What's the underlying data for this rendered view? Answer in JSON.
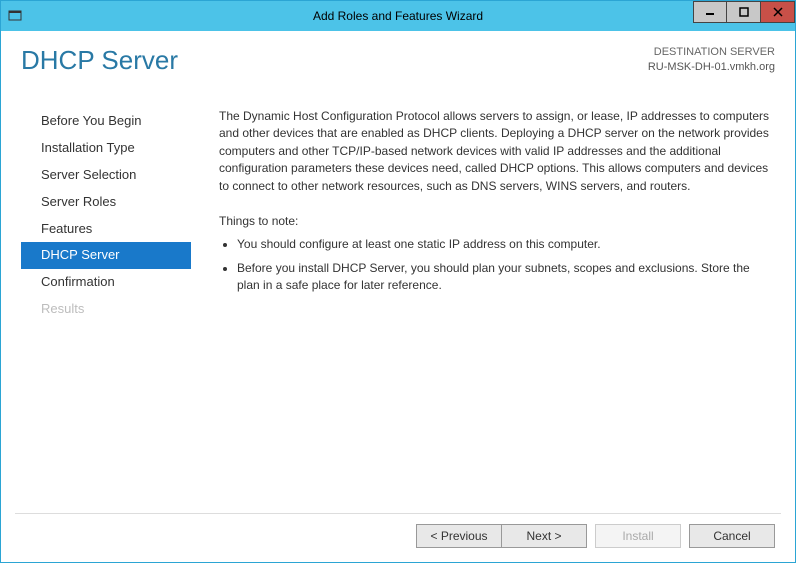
{
  "window": {
    "title": "Add Roles and Features Wizard"
  },
  "header": {
    "page_title": "DHCP Server",
    "destination_label": "DESTINATION SERVER",
    "destination_name": "RU-MSK-DH-01.vmkh.org"
  },
  "sidebar": {
    "items": [
      {
        "label": "Before You Begin",
        "selected": false,
        "disabled": false
      },
      {
        "label": "Installation Type",
        "selected": false,
        "disabled": false
      },
      {
        "label": "Server Selection",
        "selected": false,
        "disabled": false
      },
      {
        "label": "Server Roles",
        "selected": false,
        "disabled": false
      },
      {
        "label": "Features",
        "selected": false,
        "disabled": false
      },
      {
        "label": "DHCP Server",
        "selected": true,
        "disabled": false
      },
      {
        "label": "Confirmation",
        "selected": false,
        "disabled": false
      },
      {
        "label": "Results",
        "selected": false,
        "disabled": true
      }
    ]
  },
  "content": {
    "intro": "The Dynamic Host Configuration Protocol allows servers to assign, or lease, IP addresses to computers and other devices that are enabled as DHCP clients. Deploying a DHCP server on the network provides computers and other TCP/IP-based network devices with valid IP addresses and the additional configuration parameters these devices need, called DHCP options. This allows computers and devices to connect to other network resources, such as DNS servers, WINS servers, and routers.",
    "note_heading": "Things to note:",
    "bullets": [
      "You should configure at least one static IP address on this computer.",
      "Before you install DHCP Server, you should plan your subnets, scopes and exclusions. Store the plan in a safe place for later reference."
    ]
  },
  "buttons": {
    "previous": "< Previous",
    "next": "Next >",
    "install": "Install",
    "cancel": "Cancel"
  }
}
